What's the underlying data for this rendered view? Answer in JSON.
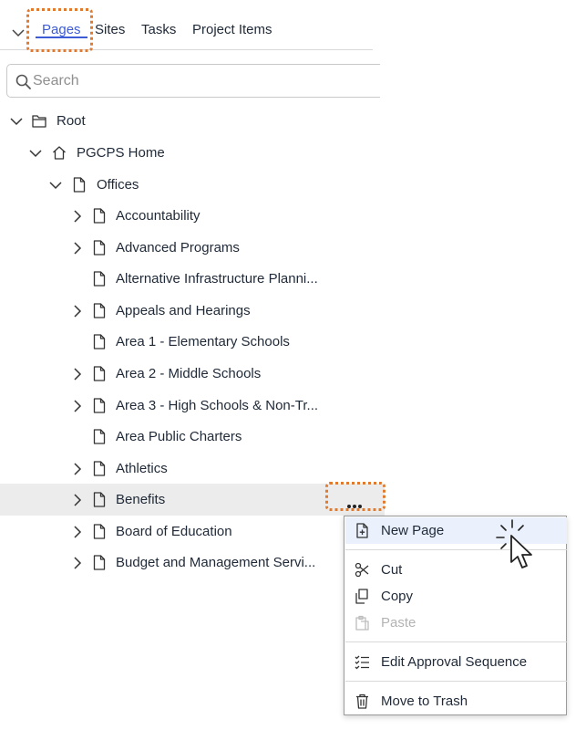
{
  "tabs": [
    {
      "label": "Pages",
      "active": true
    },
    {
      "label": "Sites"
    },
    {
      "label": "Tasks"
    },
    {
      "label": "Project Items"
    }
  ],
  "search": {
    "placeholder": "Search"
  },
  "tree": [
    {
      "label": "Root",
      "icon": "folder-icon",
      "expanded": true
    },
    {
      "label": "PGCPS Home",
      "icon": "home-icon",
      "expanded": true
    },
    {
      "label": "Offices",
      "icon": "page-icon",
      "expanded": true
    },
    {
      "label": "Accountability",
      "icon": "page-icon"
    },
    {
      "label": "Advanced Programs",
      "icon": "page-icon"
    },
    {
      "label": "Alternative Infrastructure Planni...",
      "icon": "page-icon"
    },
    {
      "label": "Appeals and Hearings",
      "icon": "page-icon"
    },
    {
      "label": "Area 1 - Elementary Schools",
      "icon": "page-icon"
    },
    {
      "label": "Area 2 - Middle Schools",
      "icon": "page-icon"
    },
    {
      "label": "Area 3 - High Schools & Non-Tr...",
      "icon": "page-icon"
    },
    {
      "label": "Area Public Charters",
      "icon": "page-icon"
    },
    {
      "label": "Athletics",
      "icon": "page-icon"
    },
    {
      "label": "Benefits",
      "icon": "page-icon",
      "selected": true
    },
    {
      "label": "Board of Education",
      "icon": "page-icon"
    },
    {
      "label": "Budget and Management Servi...",
      "icon": "page-icon"
    }
  ],
  "context_menu": {
    "items": [
      {
        "label": "New Page",
        "icon": "new-page-icon",
        "hovered": true
      },
      {
        "label": "Cut",
        "icon": "scissors-icon"
      },
      {
        "label": "Copy",
        "icon": "copy-icon"
      },
      {
        "label": "Paste",
        "icon": "paste-icon",
        "disabled": true
      },
      {
        "label": "Edit Approval Sequence",
        "icon": "approval-list-icon"
      },
      {
        "label": "Move to Trash",
        "icon": "trash-icon"
      }
    ]
  },
  "colors": {
    "accent": "#3d5bd6",
    "highlight_outline": "#e07a2f",
    "selected_row": "#ececec",
    "menu_hover": "#eaf0fc"
  }
}
